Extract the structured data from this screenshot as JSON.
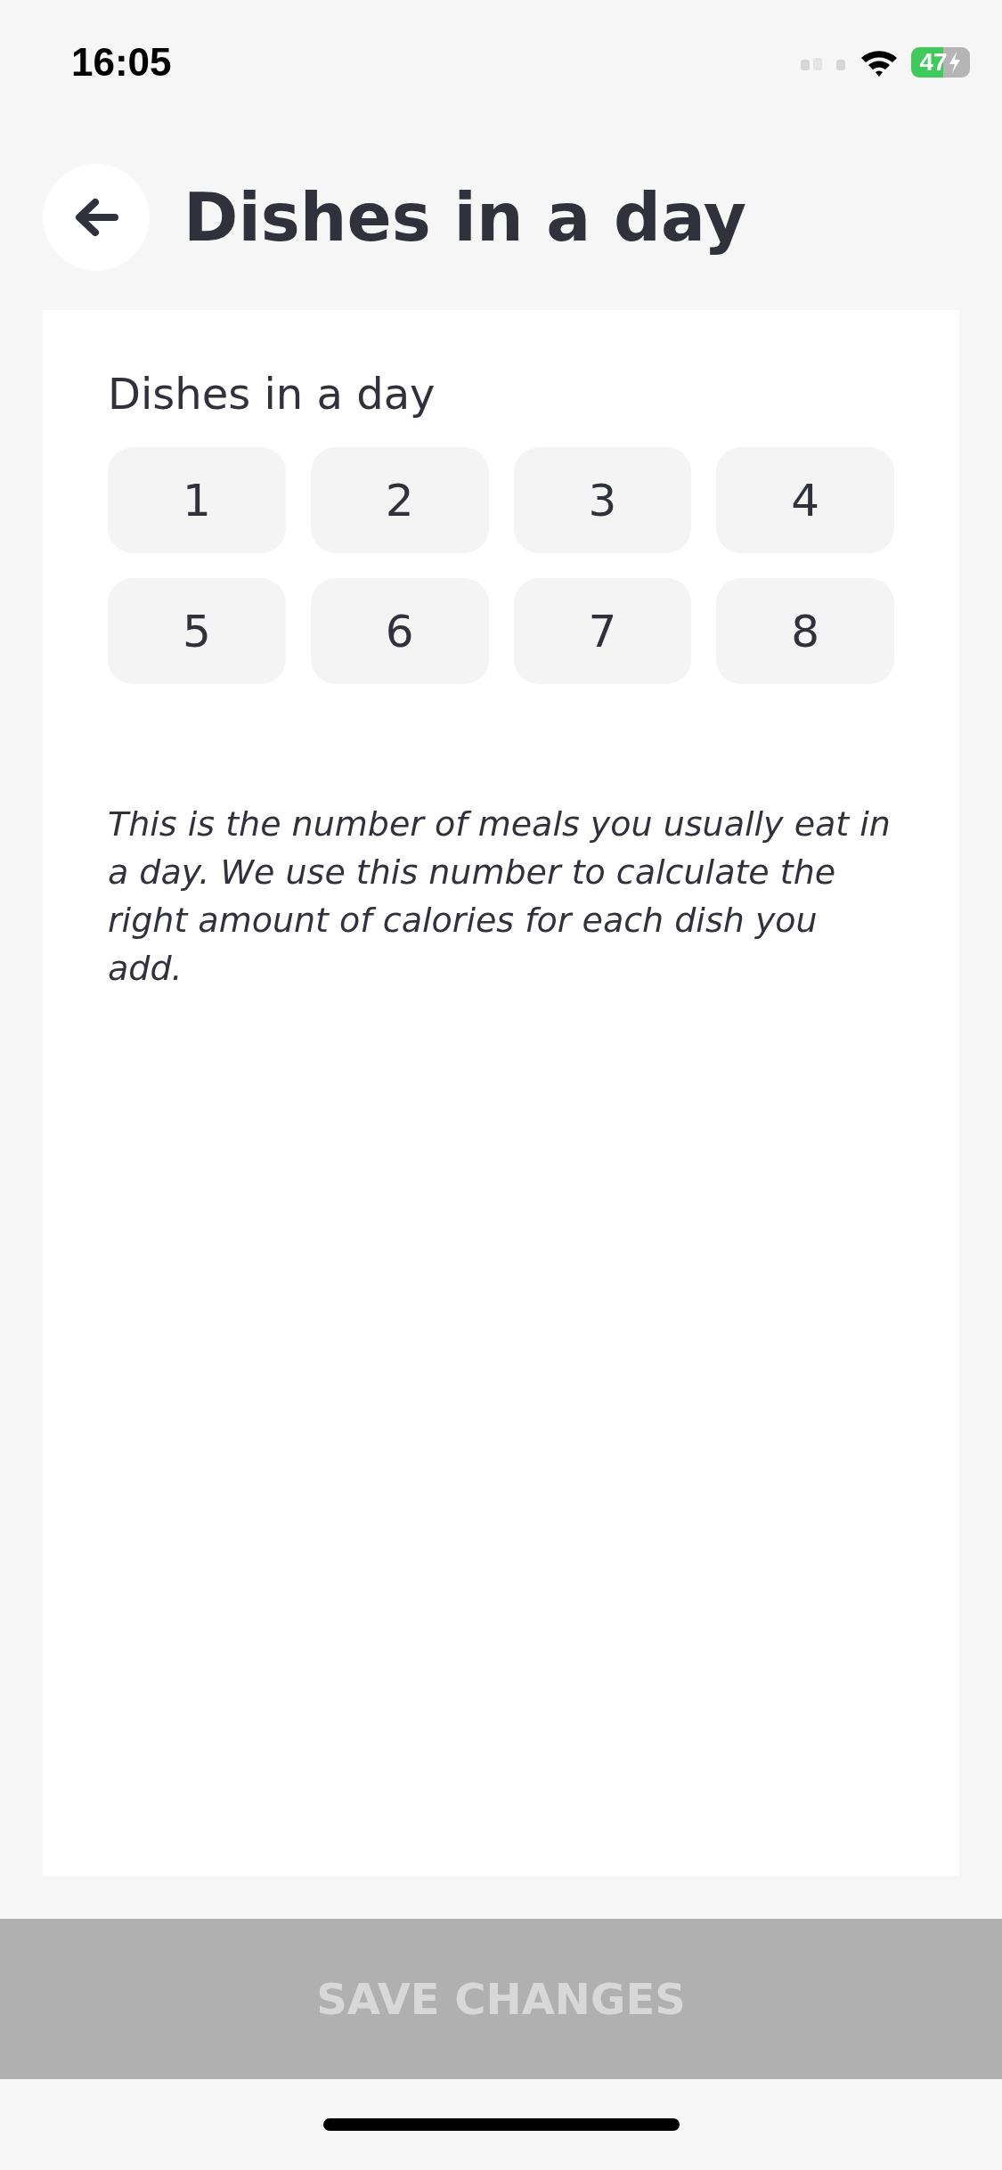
{
  "status_bar": {
    "time": "16:05",
    "battery": "47"
  },
  "header": {
    "title": "Dishes in a day"
  },
  "card": {
    "label": "Dishes in a day",
    "options": [
      {
        "label": "1",
        "selected": false
      },
      {
        "label": "2",
        "selected": false
      },
      {
        "label": "3",
        "selected": false
      },
      {
        "label": "4",
        "selected": false
      },
      {
        "label": "5",
        "selected": false
      },
      {
        "label": "6",
        "selected": false
      },
      {
        "label": "7",
        "selected": false
      },
      {
        "label": "8",
        "selected": false
      }
    ],
    "description": "This is the number of meals you usually eat in a day. We use this number to calculate the right amount of calories for each dish you add."
  },
  "save_button": {
    "label": "SAVE CHANGES",
    "disabled": true
  }
}
